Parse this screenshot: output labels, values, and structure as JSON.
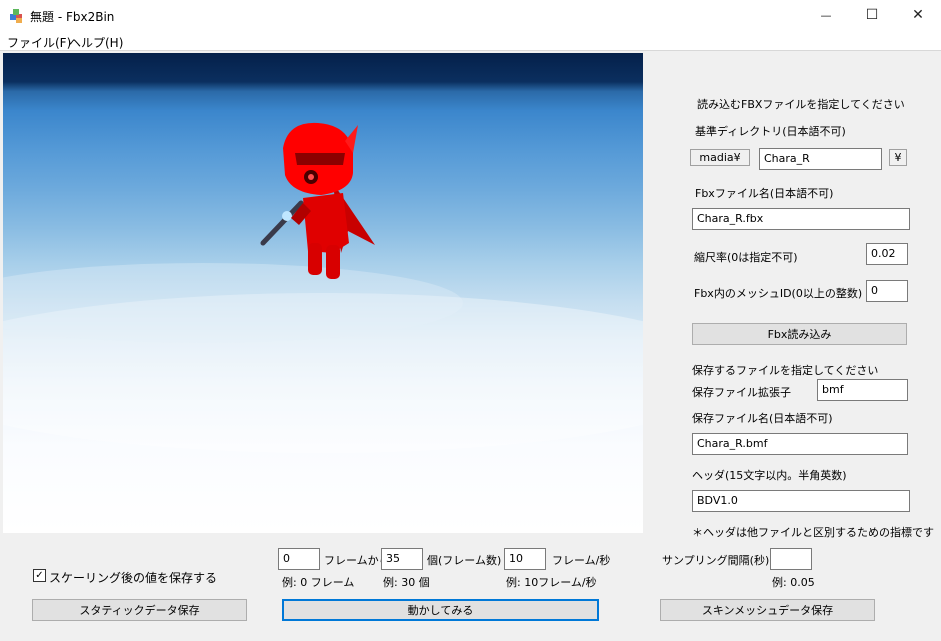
{
  "window": {
    "title": "無題 - Fbx2Bin",
    "minimize_glyph": "—",
    "maximize_glyph": "☐",
    "close_glyph": "✕"
  },
  "menu": {
    "file": "ファイル(F)",
    "help": "ヘルプ(H)"
  },
  "panel": {
    "header": "読み込むFBXファイルを指定してください",
    "base_dir_label": "基準ディレクトリ(日本語不可)",
    "base_dir_prefix": "madia¥",
    "base_dir_value": "Chara_R",
    "base_dir_suffix": "¥",
    "fbx_name_label": "Fbxファイル名(日本語不可)",
    "fbx_name_value": "Chara_R.fbx",
    "scale_label": "縮尺率(0は指定不可)",
    "scale_value": "0.02",
    "mesh_id_label": "Fbx内のメッシュID(0以上の整数)",
    "mesh_id_value": "0",
    "load_button": "Fbx読み込み",
    "save_header": "保存するファイルを指定してください",
    "save_ext_label": "保存ファイル拡張子",
    "save_ext_value": "bmf",
    "save_name_label": "保存ファイル名(日本語不可)",
    "save_name_value": "Chara_R.bmf",
    "header_label": "ヘッダ(15文字以内。半角英数)",
    "header_value": "BDV1.0",
    "header_note": "＊ヘッダは他ファイルと区別するための指標です"
  },
  "bottom": {
    "scaling_checkbox_label": "スケーリング後の値を保存する",
    "scaling_checked": true,
    "check_glyph": "✓",
    "frame_from_value": "0",
    "frame_from_label": "フレームから",
    "frame_from_example": "例: 0 フレーム",
    "frame_count_value": "35",
    "frame_count_label": "個(フレーム数)",
    "frame_count_example": "例: 30 個",
    "fps_value": "10",
    "fps_label": "フレーム/秒",
    "fps_example": "例: 10フレーム/秒",
    "sampling_label": "サンプリング間隔(秒)",
    "sampling_value": "",
    "sampling_example": "例: 0.05",
    "static_save_button": "スタティックデータ保存",
    "animate_button": "動かしてみる",
    "skin_save_button": "スキンメッシュデータ保存"
  },
  "colors": {
    "character": "#ff0000",
    "focus": "#0078d7"
  },
  "icons": {
    "app": "app-cube-icon"
  }
}
